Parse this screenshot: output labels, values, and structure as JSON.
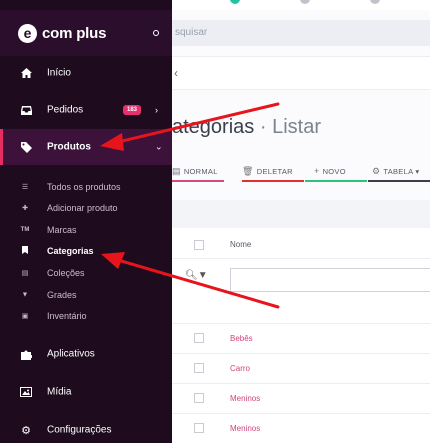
{
  "brand": {
    "name": "com plus",
    "logo_letter": "e"
  },
  "search": {
    "placeholder": "squisar"
  },
  "page": {
    "title_main": "ategorias",
    "title_sep": "·",
    "title_action": "Listar"
  },
  "toolbar": {
    "items": [
      {
        "label": "NORMAL",
        "icon": "doc-icon",
        "color": "#d64a7c"
      },
      {
        "label": "DELETAR",
        "icon": "trash-icon",
        "color": "#e0302f"
      },
      {
        "label": "NOVO",
        "icon": "plus-icon",
        "color": "#2ec27e"
      },
      {
        "label": "TABELA",
        "icon": "settings-icon",
        "color": "#3a3f4b"
      }
    ]
  },
  "table": {
    "column_header": "Nome",
    "rows": [
      "Bebês",
      "Carro",
      "Meninos",
      "Meninos"
    ]
  },
  "sidebar": {
    "items": [
      {
        "label": "Início",
        "icon": "home-icon"
      },
      {
        "label": "Pedidos",
        "icon": "inbox-icon",
        "badge": "183"
      },
      {
        "label": "Produtos",
        "icon": "tag-icon"
      }
    ],
    "sub_items": [
      {
        "label": "Todos os produtos",
        "icon": "list-icon"
      },
      {
        "label": "Adicionar produto",
        "icon": "plus-icon"
      },
      {
        "label": "Marcas",
        "icon": "TM"
      },
      {
        "label": "Categorias",
        "icon": "bookmark-icon"
      },
      {
        "label": "Coleções",
        "icon": "layers-icon"
      },
      {
        "label": "Grades",
        "icon": "filter-icon"
      },
      {
        "label": "Inventário",
        "icon": "archive-icon"
      }
    ],
    "bottom_items": [
      {
        "label": "Aplicativos",
        "icon": "puzzle-icon"
      },
      {
        "label": "Mídia",
        "icon": "image-icon"
      },
      {
        "label": "Configurações",
        "icon": "cogs-icon"
      }
    ]
  },
  "colors": {
    "sidebar_bg": "#1e0c1e",
    "sidebar_header_bg": "#2b0e2b",
    "active_bg": "#3c113a",
    "accent": "#e52d62",
    "link": "#d0457c",
    "annotation_arrow": "#e8141b"
  }
}
